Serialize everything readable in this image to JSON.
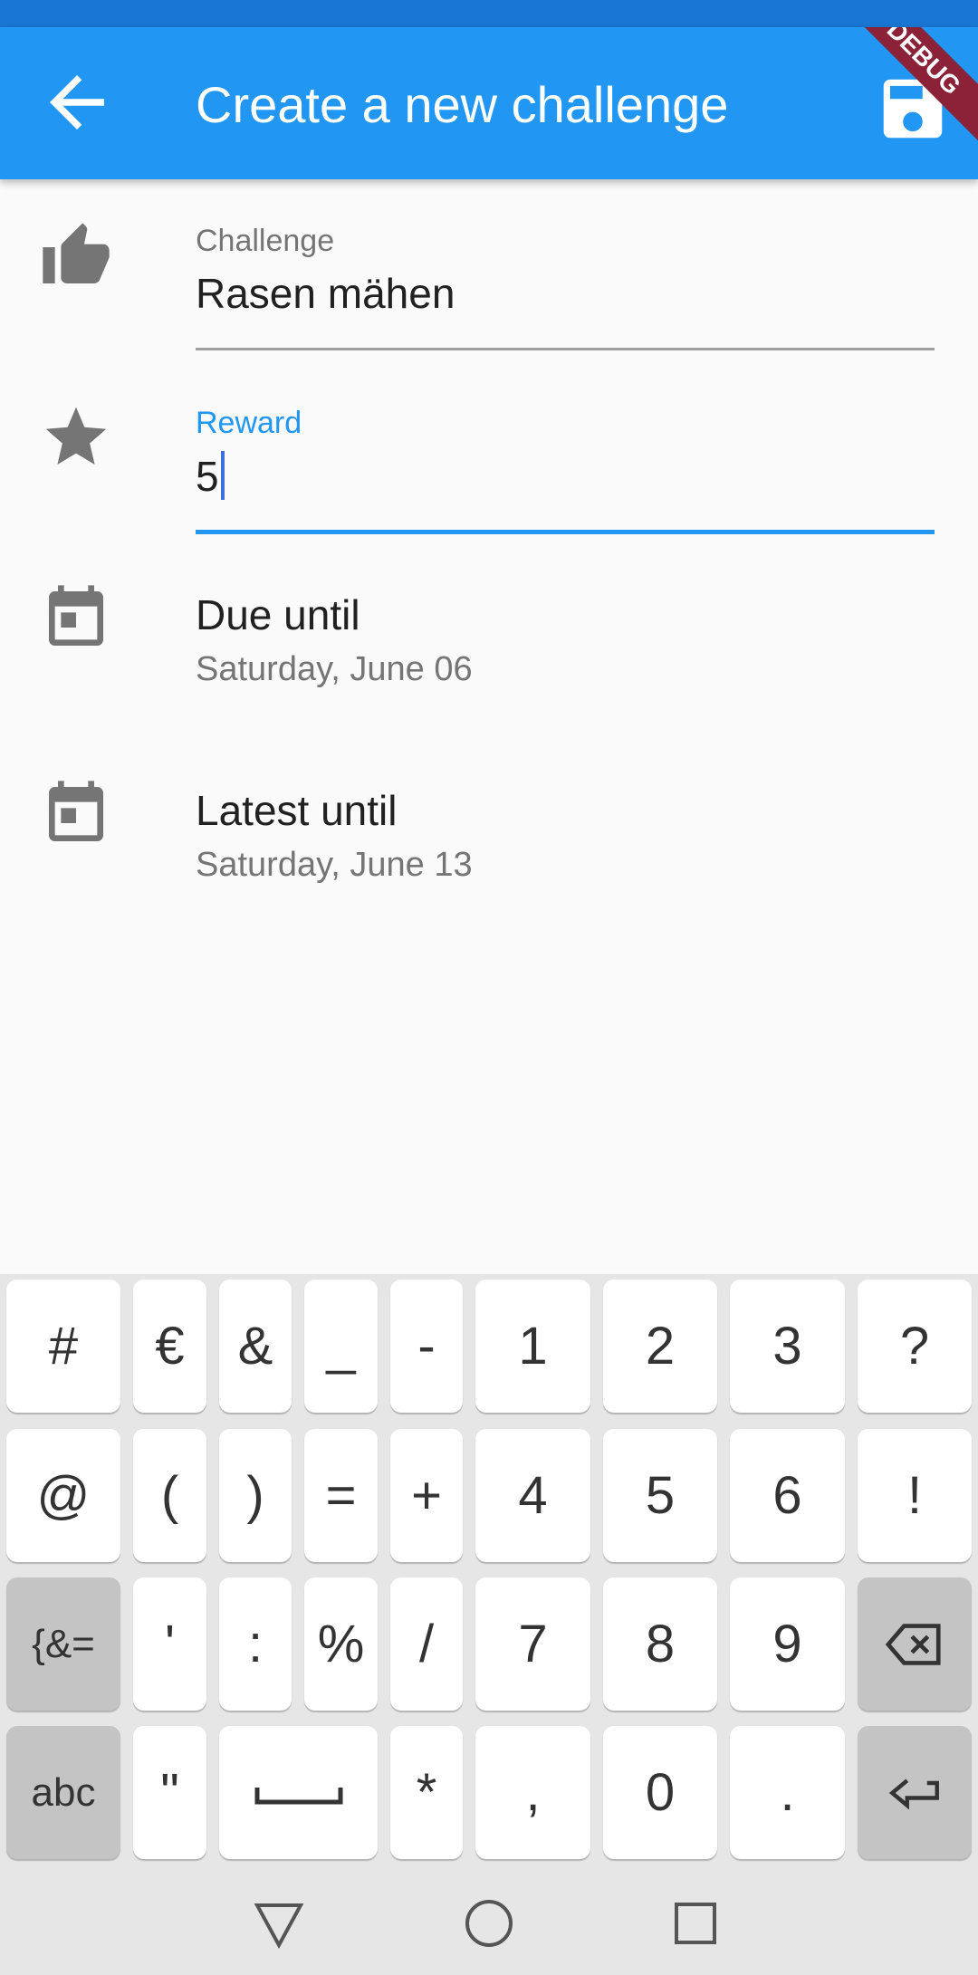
{
  "colors": {
    "accent": "#2196f3",
    "appbar": "#2196f3",
    "focus": "#2196f3"
  },
  "app_bar": {
    "title": "Create a new challenge",
    "back_icon": "arrow-back-icon",
    "save_icon": "save-icon",
    "debug_label": "DEBUG"
  },
  "form": {
    "challenge": {
      "label": "Challenge",
      "value": "Rasen mähen",
      "icon": "thumb-up-icon"
    },
    "reward": {
      "label": "Reward",
      "value": "5",
      "icon": "star-icon",
      "focused": true
    },
    "due": {
      "title": "Due until",
      "date": "Saturday, June 06",
      "icon": "calendar-icon"
    },
    "latest": {
      "title": "Latest until",
      "date": "Saturday, June 13",
      "icon": "calendar-icon"
    }
  },
  "keyboard": {
    "rows": [
      [
        "#",
        "€",
        "&",
        "_",
        "-",
        "1",
        "2",
        "3",
        "?"
      ],
      [
        "@",
        "(",
        ")",
        "=",
        "+",
        "4",
        "5",
        "6",
        "!"
      ],
      [
        "{&=",
        "'",
        ":",
        "%",
        "/",
        "7",
        "8",
        "9",
        "backspace-icon"
      ],
      [
        "abc",
        "\"",
        "space-icon",
        "*",
        ",",
        "0",
        ".",
        "enter-icon"
      ]
    ]
  },
  "navbar": {
    "back": "triangle-back-icon",
    "home": "circle-home-icon",
    "recents": "square-recents-icon"
  }
}
